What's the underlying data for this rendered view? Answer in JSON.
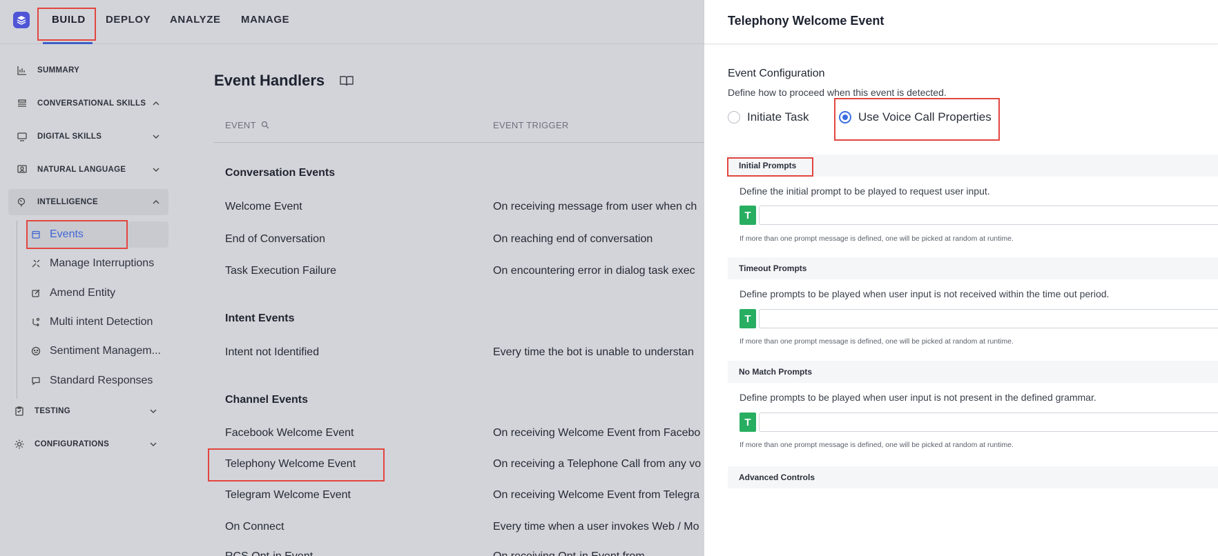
{
  "topnav": {
    "tabs": [
      {
        "label": "BUILD",
        "active": true
      },
      {
        "label": "DEPLOY"
      },
      {
        "label": "ANALYZE"
      },
      {
        "label": "MANAGE"
      }
    ]
  },
  "sidebar": {
    "items": [
      {
        "label": "SUMMARY",
        "icon": "bar-chart-icon"
      },
      {
        "label": "CONVERSATIONAL SKILLS",
        "icon": "stack-icon",
        "expanded": true
      },
      {
        "label": "DIGITAL SKILLS",
        "icon": "monitor-icon"
      },
      {
        "label": "NATURAL LANGUAGE",
        "icon": "user-card-icon"
      },
      {
        "label": "INTELLIGENCE",
        "icon": "brain-icon",
        "expanded": true
      },
      {
        "label": "TESTING",
        "icon": "clipboard-icon"
      },
      {
        "label": "CONFIGURATIONS",
        "icon": "gear-icon"
      }
    ],
    "intelligence_sub": [
      {
        "label": "Events",
        "icon": "calendar-icon",
        "active": true
      },
      {
        "label": "Manage Interruptions",
        "icon": "interrupt-icon"
      },
      {
        "label": "Amend Entity",
        "icon": "edit-icon"
      },
      {
        "label": "Multi intent Detection",
        "icon": "multi-intent-icon"
      },
      {
        "label": "Sentiment Managem...",
        "icon": "smiley-icon"
      },
      {
        "label": "Standard Responses",
        "icon": "chat-bubble-icon"
      }
    ]
  },
  "main": {
    "title": "Event Handlers",
    "columns": {
      "event": "EVENT",
      "trigger": "EVENT TRIGGER"
    },
    "groups": [
      {
        "name": "Conversation Events",
        "rows": [
          {
            "event": "Welcome Event",
            "trigger": "On receiving message from user when ch"
          },
          {
            "event": "End of Conversation",
            "trigger": "On reaching end of conversation"
          },
          {
            "event": "Task Execution Failure",
            "trigger": "On encountering error in dialog task exec"
          }
        ]
      },
      {
        "name": "Intent Events",
        "rows": [
          {
            "event": "Intent not Identified",
            "trigger": "Every time the bot is unable to understan"
          }
        ]
      },
      {
        "name": "Channel Events",
        "rows": [
          {
            "event": "Facebook Welcome Event",
            "trigger": "On receiving Welcome Event from Facebo"
          },
          {
            "event": "Telephony Welcome Event",
            "trigger": "On receiving a Telephone Call from any vo"
          },
          {
            "event": "Telegram Welcome Event",
            "trigger": "On receiving Welcome Event from Telegra"
          },
          {
            "event": "On Connect",
            "trigger": "Every time when a user invokes Web / Mo"
          },
          {
            "event": "RCS Opt-in Event",
            "trigger": "On receiving Opt-in Event from"
          }
        ]
      }
    ]
  },
  "panel": {
    "title": "Telephony Welcome Event",
    "config_title": "Event Configuration",
    "config_desc": "Define how to proceed when this event is detected.",
    "radio_options": [
      {
        "label": "Initiate Task",
        "selected": false
      },
      {
        "label": "Use Voice Call Properties",
        "selected": true
      }
    ],
    "sections": [
      {
        "title": "Initial Prompts",
        "desc": "Define the initial prompt to be played to request user input.",
        "hint": "If more than one prompt message is defined, one will be picked at random at runtime."
      },
      {
        "title": "Timeout Prompts",
        "desc": "Define prompts to be played when user input is not received within the time out period.",
        "hint": "If more than one prompt message is defined, one will be picked at random at runtime."
      },
      {
        "title": "No Match Prompts",
        "desc": "Define prompts to be played when user input is not present in the defined grammar.",
        "hint": "If more than one prompt message is defined, one will be picked at random at runtime."
      }
    ],
    "advanced_title": "Advanced Controls",
    "text_button_label": "T"
  },
  "colors": {
    "accent": "#3b6fe0",
    "highlight": "#e2453f",
    "text_prompt_green": "#27ae60",
    "logo": "#4f55d6"
  }
}
